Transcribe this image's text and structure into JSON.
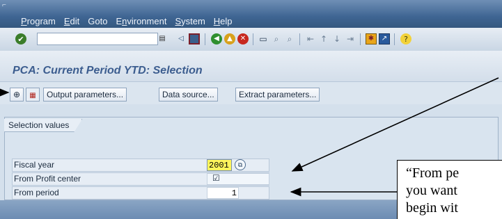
{
  "window": {
    "system_mark": "⌐"
  },
  "menu": {
    "items": [
      {
        "label_pre": "",
        "accel": "P",
        "label_post": "rogram"
      },
      {
        "label_pre": "",
        "accel": "E",
        "label_post": "dit"
      },
      {
        "label_pre": "Goto",
        "accel": "",
        "label_post": ""
      },
      {
        "label_pre": "E",
        "accel": "n",
        "label_post": "vironment"
      },
      {
        "label_pre": "",
        "accel": "S",
        "label_post": "ystem"
      },
      {
        "label_pre": "",
        "accel": "H",
        "label_post": "elp"
      }
    ]
  },
  "toolbar": {
    "command_field_value": "",
    "icons": [
      "enter-icon",
      "history-dropdown-icon",
      "back-arrow-icon",
      "save-icon",
      "back-icon",
      "exit-icon",
      "cancel-icon",
      "print-icon",
      "find-icon",
      "find-next-icon",
      "first-page-icon",
      "previous-page-icon",
      "next-page-icon",
      "last-page-icon",
      "create-session-icon",
      "shortcut-icon",
      "help-icon"
    ]
  },
  "page": {
    "title": "PCA: Current Period YTD: Selection"
  },
  "app_toolbar": {
    "output_parameters": "Output parameters...",
    "data_source": "Data source...",
    "extract_parameters": "Extract parameters..."
  },
  "selection": {
    "group_title": "Selection values",
    "fields": {
      "fiscal_year": {
        "label": "Fiscal year",
        "value": "2001"
      },
      "from_profit_center": {
        "label": "From Profit center",
        "checked": true
      },
      "from_period": {
        "label": "From period",
        "value": "1"
      }
    }
  },
  "annotation": {
    "text": "“From pe\nyou want\nbegin wit"
  },
  "colors": {
    "menubar": "#3f6593",
    "title": "#3c5d8f",
    "required_field": "#fff55c",
    "background": "#d4e0ec"
  }
}
